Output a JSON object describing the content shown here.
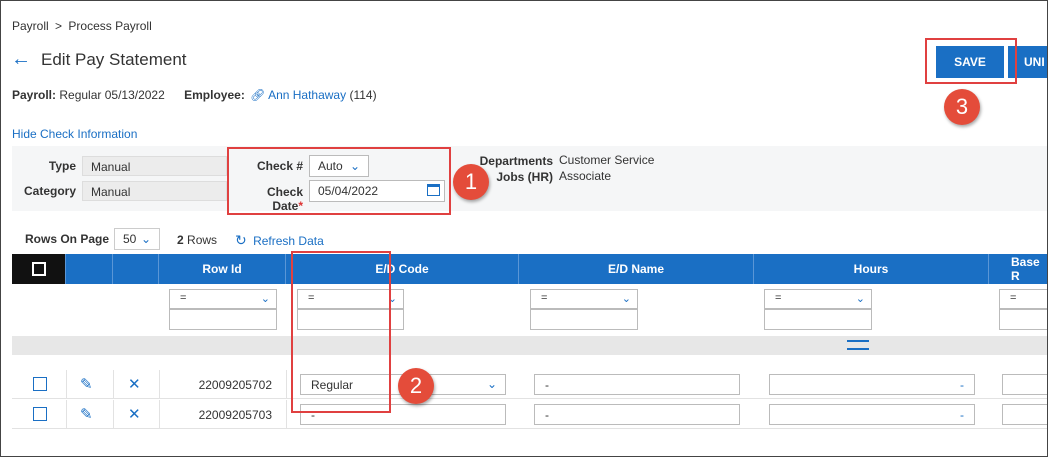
{
  "breadcrumb": {
    "root": "Payroll",
    "sep": ">",
    "current": "Process Payroll"
  },
  "page": {
    "title": "Edit Pay Statement"
  },
  "meta": {
    "payroll_label": "Payroll:",
    "payroll_value": "Regular 05/13/2022",
    "employee_label": "Employee:",
    "employee_name": "Ann Hathaway",
    "employee_id": "(114)"
  },
  "toolbar": {
    "save_label": "SAVE",
    "undo_label": "UNI"
  },
  "check_info": {
    "toggle_label": "Hide Check Information",
    "type_label": "Type",
    "type_value": "Manual",
    "category_label": "Category",
    "category_value": "Manual",
    "check_no_label": "Check #",
    "check_no_value": "Auto",
    "check_date_label": "Check Date",
    "check_date_required": "*",
    "check_date_value": "05/04/2022",
    "departments_label": "Departments",
    "departments_value": "Customer Service",
    "jobs_label": "Jobs (HR)",
    "jobs_value": "Associate"
  },
  "paging": {
    "rows_on_page_label": "Rows On Page",
    "rows_on_page_value": "50",
    "row_count": "2",
    "row_count_label": "Rows",
    "refresh_label": "Refresh Data"
  },
  "grid": {
    "columns": [
      "Row Id",
      "E/D Code",
      "E/D Name",
      "Hours",
      "Base R"
    ],
    "filter_op": "=",
    "rows": [
      {
        "row_id": "22009205702",
        "ed_code": "Regular",
        "ed_name": "-",
        "hours": "-"
      },
      {
        "row_id": "22009205703",
        "ed_code": "-",
        "ed_name": "-",
        "hours": "-"
      }
    ]
  },
  "callouts": [
    "1",
    "2",
    "3"
  ],
  "colors": {
    "accent": "#1a6fc4",
    "callout": "#e44c3a"
  }
}
